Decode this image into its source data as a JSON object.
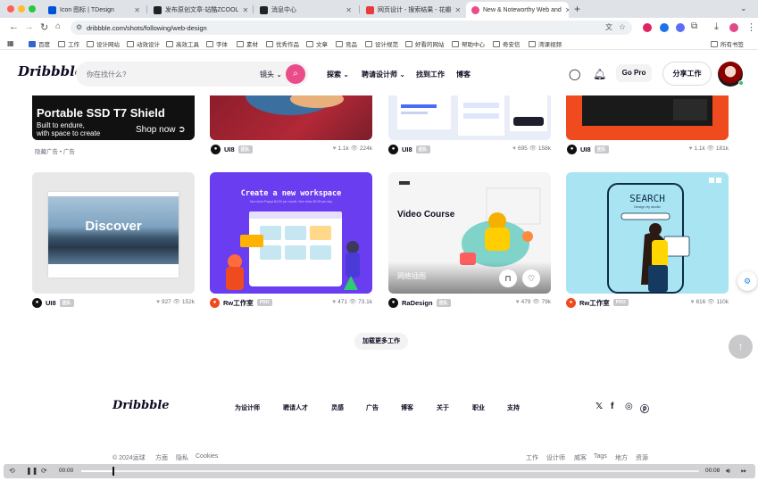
{
  "browser": {
    "tabs": [
      {
        "title": "Icon 图标 | TDesign",
        "active": false
      },
      {
        "title": "发布原创文章-站酷ZCOOL",
        "active": false
      },
      {
        "title": "消息中心",
        "active": false
      },
      {
        "title": "网页设计 - 搜索结果 - 花瓣",
        "active": false
      },
      {
        "title": "New & Noteworthy Web and",
        "active": true
      }
    ],
    "new_tab_label": "+",
    "url": "dribbble.com/shots/following/web-design",
    "bookmarks": [
      "百度",
      "工作",
      "设计网站",
      "动效设计",
      "高效工具",
      "字体",
      "素材",
      "优秀作品",
      "文章",
      "竞品",
      "设计规范",
      "好看的网站",
      "帮助中心",
      "奇安信",
      "湾课视频"
    ],
    "all_bookmarks_label": "所有书签",
    "colors": {
      "tab_bg": "#dfe3e8",
      "accent_pink": "#ea4c89"
    }
  },
  "header": {
    "logo": "Dribbble",
    "search_placeholder": "你在找什么?",
    "search_kind": "镜头",
    "nav": [
      "探索",
      "聘请设计师",
      "找到工作",
      "博客"
    ],
    "go_pro": "Go Pro",
    "share_work": "分享工作"
  },
  "ad_tag": "隐藏广告 • 广告",
  "top_row": [
    {
      "user": "",
      "badge": "",
      "likes": "",
      "views": "",
      "ad": {
        "title": "Portable SSD T7 Shield",
        "subtitle_1": "Built to endure,",
        "subtitle_2": "with space to create",
        "cta": "Shop now"
      }
    },
    {
      "user": "UI8",
      "badge": "团队",
      "likes": "1.1k",
      "views": "224k"
    },
    {
      "user": "UI8",
      "badge": "团队",
      "likes": "695",
      "views": "158k"
    },
    {
      "user": "UI8",
      "badge": "团队",
      "likes": "1.1k",
      "views": "181k"
    }
  ],
  "bottom_row": [
    {
      "user": "UI8",
      "badge": "团队",
      "likes": "927",
      "views": "152k",
      "card_text": "Discover"
    },
    {
      "user": "Rw工作室",
      "badge": "PRO",
      "likes": "471",
      "views": "73.1k",
      "card_title": "Create a new workspace",
      "card_sub": "Non dolor Popya $4.50 per month. Non dolor $0.99 per day"
    },
    {
      "user": "RaDesign",
      "badge": "团队",
      "likes": "479",
      "views": "79k",
      "card_title": "Video Course",
      "hover_title": "网络插图"
    },
    {
      "user": "Rw工作室",
      "badge": "PRO",
      "likes": "616",
      "views": "110k",
      "card_title": "SEARCH",
      "card_sub": "Design by studio"
    }
  ],
  "load_more": "加载更多工作",
  "footer": {
    "logo": "Dribbble",
    "links": [
      "为设计师",
      "聘请人才",
      "灵感",
      "广告",
      "博客",
      "关于",
      "职业",
      "支持"
    ],
    "copyright": "© 2024运球",
    "legal": [
      "方面",
      "隐私",
      "Cookies"
    ],
    "right_links": [
      "工作",
      "设计师",
      "威客",
      "Tags",
      "地方",
      "资源"
    ]
  },
  "player": {
    "current_time": "00:00",
    "total_time": "00:08",
    "progress": 0.05
  }
}
